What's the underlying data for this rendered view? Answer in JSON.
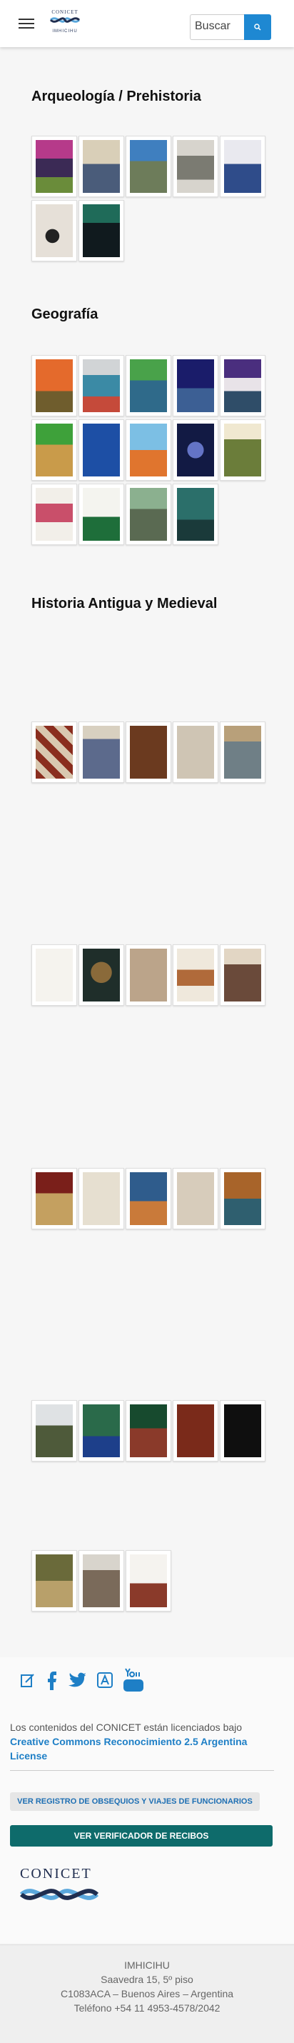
{
  "header": {
    "search_placeholder": "Buscar",
    "logo_top": "CONICET",
    "logo_bottom": "IMHICIHU"
  },
  "sections": [
    {
      "title": "Arqueología / Prehistoria"
    },
    {
      "title": "Geografía"
    },
    {
      "title": "Historia Antigua y Medieval"
    }
  ],
  "footer": {
    "license_text": "Los contenidos del CONICET están licenciados bajo ",
    "license_link": "Creative Commons Reconocimiento 2.5 Argentina License",
    "registro_button": "VER REGISTRO DE OBSEQUIOS Y VIAJES DE FUNCIONARIOS",
    "verificador_button": "VER VERIFICADOR DE RECIBOS",
    "conicet_logo": "CONICET",
    "address": {
      "name": "IMHICIHU",
      "street": "Saavedra 15, 5º piso",
      "city": "C1083ACA – Buenos Aires – Argentina",
      "phone": "Teléfono +54 11 4953-4578/2042"
    }
  },
  "colors": {
    "accent": "#1e88d2",
    "teal_button": "#0e6b6b",
    "link": "#1e7fc6"
  }
}
